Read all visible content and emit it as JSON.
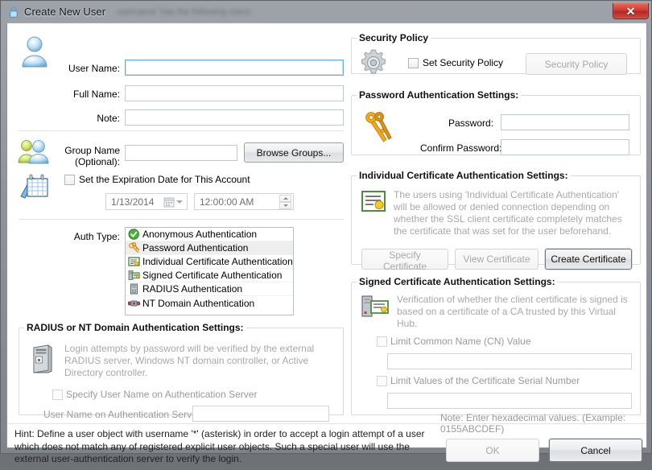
{
  "window": {
    "title": "Create New User",
    "ghost_text": "username' has the following users",
    "close_label": "×"
  },
  "user": {
    "username_label": "User Name:",
    "username_value": "",
    "fullname_label": "Full Name:",
    "fullname_value": "",
    "note_label": "Note:",
    "note_value": ""
  },
  "group": {
    "label_line1": "Group Name",
    "label_line2": "(Optional):",
    "value": "",
    "browse_button": "Browse Groups..."
  },
  "expiration": {
    "checkbox_label": "Set the Expiration Date for This Account",
    "checked": false,
    "date_value": "1/13/2014",
    "time_value": "12:00:00 AM"
  },
  "auth": {
    "label": "Auth Type:",
    "selected_index": 1,
    "items": [
      {
        "label": "Anonymous Authentication",
        "icon": "green-check-icon"
      },
      {
        "label": "Password Authentication",
        "icon": "key-icon"
      },
      {
        "label": "Individual Certificate Authentication",
        "icon": "certificate-icon"
      },
      {
        "label": "Signed Certificate Authentication",
        "icon": "signed-certificate-icon"
      },
      {
        "label": "RADIUS Authentication",
        "icon": "server-icon"
      },
      {
        "label": "NT Domain Authentication",
        "icon": "nt-domain-icon"
      }
    ]
  },
  "radius": {
    "legend": "RADIUS or NT Domain Authentication Settings:",
    "description": "Login attempts by password will be verified by the external RADIUS server, Windows NT domain controller, or Active Directory controller.",
    "specify_checkbox_label": "Specify User Name on Authentication Server",
    "specify_checked": false,
    "username_label": "User Name on Authentication Server:",
    "username_value": ""
  },
  "security_policy": {
    "legend": "Security Policy",
    "checkbox_label": "Set Security Policy",
    "checked": false,
    "button_label": "Security Policy"
  },
  "password_auth": {
    "legend": "Password Authentication Settings:",
    "password_label": "Password:",
    "password_value": "",
    "confirm_label": "Confirm Password:",
    "confirm_value": ""
  },
  "individual_cert": {
    "legend": "Individual Certificate Authentication Settings:",
    "description": "The users using 'Individual Certificate Authentication' will be allowed or denied connection depending on whether the SSL client certificate completely matches the certificate that was set for the user beforehand.",
    "specify_button": "Specify Certificate",
    "view_button": "View Certificate",
    "create_button": "Create Certificate"
  },
  "signed_cert": {
    "legend": "Signed Certificate Authentication Settings:",
    "description": "Verification of whether the client certificate is signed is based on a certificate of a CA trusted by this Virtual Hub.",
    "cn_checkbox_label": "Limit Common Name (CN) Value",
    "cn_checked": false,
    "cn_value": "",
    "serial_checkbox_label": "Limit Values of the Certificate Serial Number",
    "serial_checked": false,
    "serial_value": "",
    "note": "Note: Enter hexadecimal values. (Example: 0155ABCDEF)"
  },
  "footer": {
    "hint": "Hint: Define a user object with username '*' (asterisk) in order to accept a login attempt of a user which does not match any of registered explicit user objects. Such a special user will use the external user-authentication server to verify the login.",
    "ok_label": "OK",
    "cancel_label": "Cancel"
  },
  "colors": {
    "accent_focus": "#6faadd",
    "close_red": "#d23a32",
    "disabled_text": "#a9a9a9"
  }
}
